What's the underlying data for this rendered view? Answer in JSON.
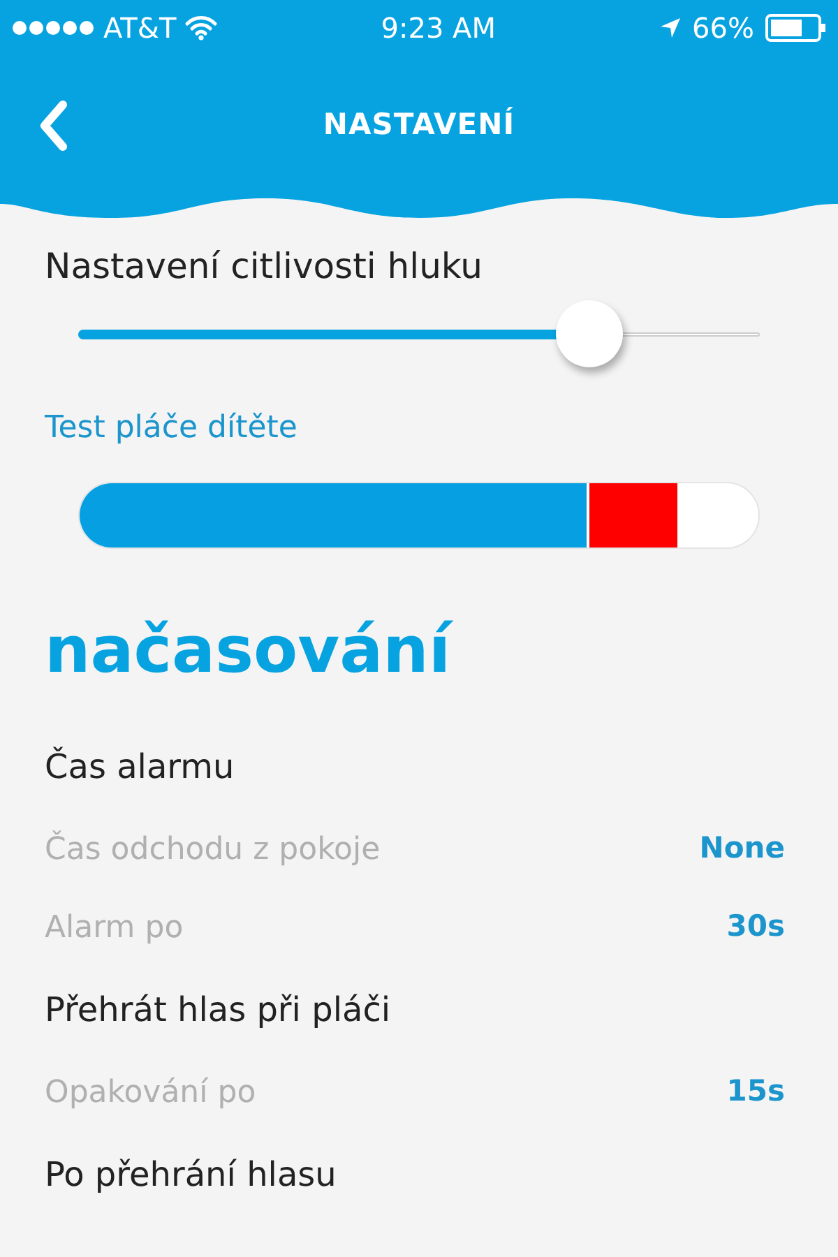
{
  "status_bar": {
    "carrier": "AT&T",
    "time": "9:23 AM",
    "battery": "66%"
  },
  "header": {
    "title": "NASTAVENÍ"
  },
  "sensitivity": {
    "label": "Nastavení citlivosti hluku",
    "level": 0.75
  },
  "cry_test": {
    "label": "Test pláče dítěte",
    "level": 0.88
  },
  "section_title": "načasování",
  "rows": [
    {
      "kind": "heading",
      "label": "Čas alarmu"
    },
    {
      "kind": "setting",
      "label": "Čas odchodu z pokoje",
      "value": "None"
    },
    {
      "kind": "setting",
      "label": "Alarm po",
      "value": "30s"
    },
    {
      "kind": "heading",
      "label": "Přehrát hlas při pláči"
    },
    {
      "kind": "setting",
      "label": "Opakování po",
      "value": "15s"
    },
    {
      "kind": "heading",
      "label": "Po přehrání hlasu"
    }
  ]
}
